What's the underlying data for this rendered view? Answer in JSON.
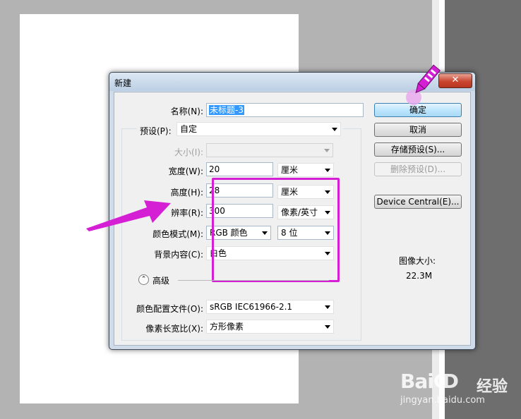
{
  "dialog": {
    "title": "新建",
    "close_glyph": "✕",
    "name_label": "名称(N):",
    "name_value": "未标题-3",
    "preset_label": "预设(P):",
    "preset_value": "自定",
    "size_label": "大小(I):",
    "width_label": "宽度(W):",
    "width_value": "20",
    "width_unit": "厘米",
    "height_label": "高度(H):",
    "height_value": "28",
    "height_unit": "厘米",
    "resolution_label": "辨率(R):",
    "resolution_value": "300",
    "resolution_unit": "像素/英寸",
    "color_mode_label": "颜色模式(M):",
    "color_mode_value": "RGB 颜色",
    "bit_depth_value": "8 位",
    "bg_label": "背景内容(C):",
    "bg_value": "白色",
    "advanced_label": "高级",
    "advanced_glyph": "⌃",
    "color_profile_label": "颜色配置文件(O):",
    "color_profile_value": "sRGB IEC61966-2.1",
    "pixel_aspect_label": "像素长宽比(X):",
    "pixel_aspect_value": "方形像素",
    "buttons": {
      "ok": "确定",
      "cancel": "取消",
      "save_preset": "存储预设(S)...",
      "delete_preset": "删除预设(D)...",
      "device_central": "Device Central(E)..."
    },
    "image_size_label": "图像大小:",
    "image_size_value": "22.3M"
  },
  "watermark": {
    "logo": "Baiↀ",
    "brand": "经验",
    "url": "jingyan.baidu.com"
  },
  "colors": {
    "annotation": "#d41fd4",
    "selection": "#3399ff"
  }
}
